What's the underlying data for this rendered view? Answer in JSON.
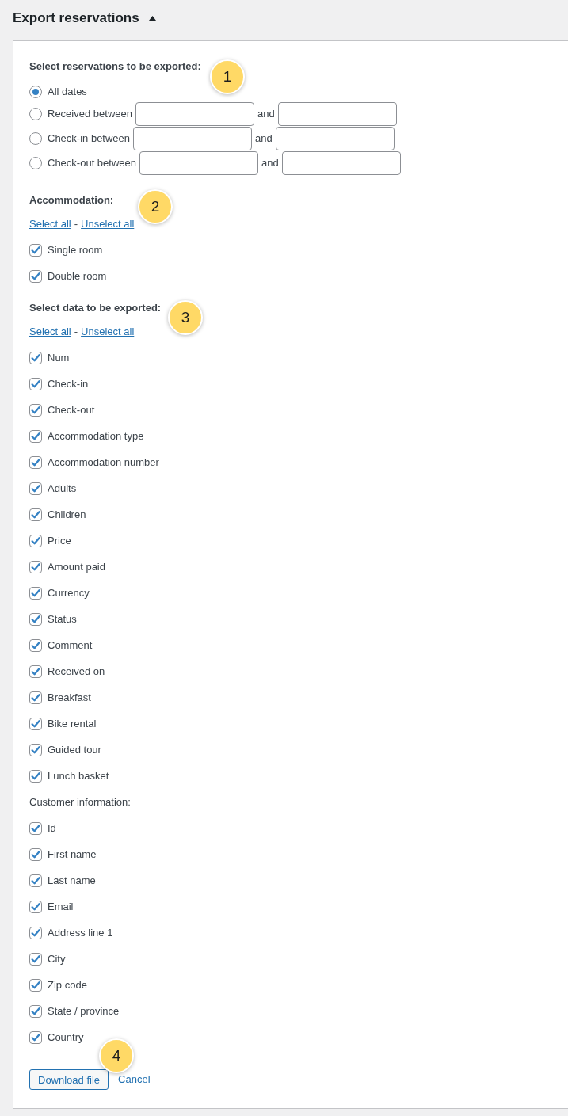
{
  "panel": {
    "title": "Export reservations",
    "expanded": true
  },
  "reservations": {
    "heading": "Select reservations to be exported:",
    "badge": "1",
    "options": [
      {
        "kind": "all",
        "label": "All dates",
        "selected": true
      },
      {
        "kind": "range",
        "label": "Received between",
        "joiner": "and",
        "selected": false
      },
      {
        "kind": "range",
        "label": "Check-in between",
        "joiner": "and",
        "selected": false
      },
      {
        "kind": "range",
        "label": "Check-out between",
        "joiner": "and",
        "selected": false
      }
    ]
  },
  "accommodation": {
    "heading": "Accommodation:",
    "badge": "2",
    "select_all": "Select all",
    "separator": "-",
    "unselect_all": "Unselect all",
    "items": [
      {
        "label": "Single room",
        "checked": true
      },
      {
        "label": "Double room",
        "checked": true
      }
    ]
  },
  "export_data": {
    "heading": "Select data to be exported:",
    "badge": "3",
    "select_all": "Select all",
    "separator": "-",
    "unselect_all": "Unselect all",
    "items": [
      {
        "label": "Num",
        "checked": true
      },
      {
        "label": "Check-in",
        "checked": true
      },
      {
        "label": "Check-out",
        "checked": true
      },
      {
        "label": "Accommodation type",
        "checked": true
      },
      {
        "label": "Accommodation number",
        "checked": true
      },
      {
        "label": "Adults",
        "checked": true
      },
      {
        "label": "Children",
        "checked": true
      },
      {
        "label": "Price",
        "checked": true
      },
      {
        "label": "Amount paid",
        "checked": true
      },
      {
        "label": "Currency",
        "checked": true
      },
      {
        "label": "Status",
        "checked": true
      },
      {
        "label": "Comment",
        "checked": true
      },
      {
        "label": "Received on",
        "checked": true
      },
      {
        "label": "Breakfast",
        "checked": true
      },
      {
        "label": "Bike rental",
        "checked": true
      },
      {
        "label": "Guided tour",
        "checked": true
      },
      {
        "label": "Lunch basket",
        "checked": true
      }
    ],
    "customer_heading": "Customer information:",
    "customer_items": [
      {
        "label": "Id",
        "checked": true
      },
      {
        "label": "First name",
        "checked": true
      },
      {
        "label": "Last name",
        "checked": true
      },
      {
        "label": "Email",
        "checked": true
      },
      {
        "label": "Address line 1",
        "checked": true
      },
      {
        "label": "City",
        "checked": true
      },
      {
        "label": "Zip code",
        "checked": true
      },
      {
        "label": "State / province",
        "checked": true
      },
      {
        "label": "Country",
        "checked": true
      }
    ]
  },
  "actions": {
    "badge": "4",
    "download_button": "Download file",
    "cancel_link": "Cancel"
  }
}
